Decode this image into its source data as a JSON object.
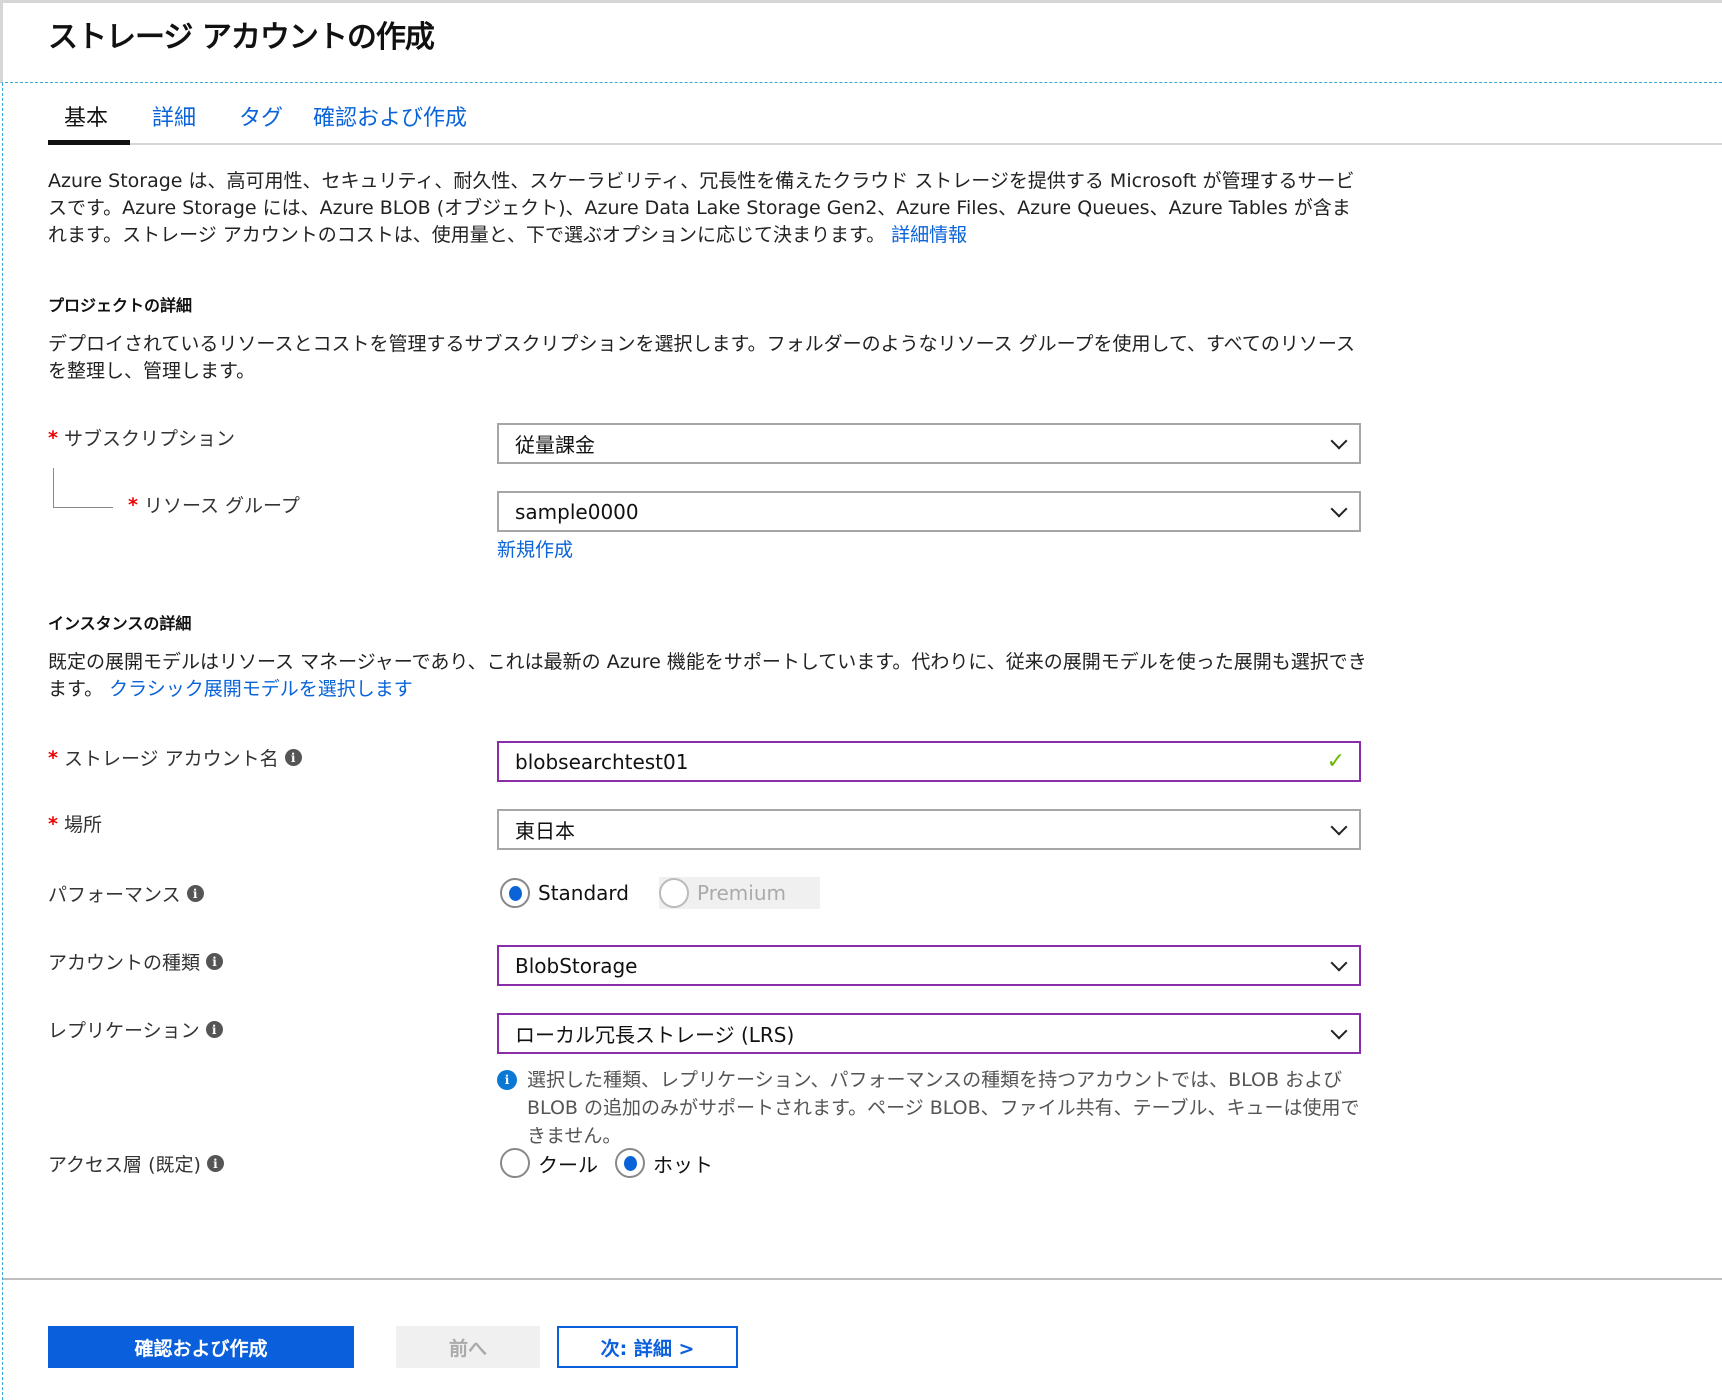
{
  "title": "ストレージ アカウントの作成",
  "tabs": [
    {
      "label": "基本"
    },
    {
      "label": "詳細"
    },
    {
      "label": "タグ"
    },
    {
      "label": "確認および作成"
    }
  ],
  "intro": {
    "text": "Azure Storage は、高可用性、セキュリティ、耐久性、スケーラビリティ、冗長性を備えたクラウド ストレージを提供する Microsoft が管理するサービスです。Azure Storage には、Azure BLOB (オブジェクト)、Azure Data Lake Storage Gen2、Azure Files、Azure Queues、Azure Tables が含まれます。ストレージ アカウントのコストは、使用量と、下で選ぶオプションに応じて決まります。 ",
    "link": "詳細情報"
  },
  "project": {
    "heading": "プロジェクトの詳細",
    "desc": "デプロイされているリソースとコストを管理するサブスクリプションを選択します。フォルダーのようなリソース グループを使用して、すべてのリソースを整理し、管理します。",
    "subscription": {
      "label": "サブスクリプション",
      "value": "従量課金"
    },
    "resource_group": {
      "label": "リソース グループ",
      "value": "sample0000",
      "create_new": "新規作成"
    }
  },
  "instance": {
    "heading": "インスタンスの詳細",
    "desc": "既定の展開モデルはリソース マネージャーであり、これは最新の Azure 機能をサポートしています。代わりに、従来の展開モデルを使った展開も選択できます。 ",
    "link": "クラシック展開モデルを選択します",
    "account_name": {
      "label": "ストレージ アカウント名",
      "value": "blobsearchtest01"
    },
    "location": {
      "label": "場所",
      "value": "東日本"
    },
    "performance": {
      "label": "パフォーマンス",
      "options": [
        "Standard",
        "Premium"
      ],
      "selected": "Standard"
    },
    "account_kind": {
      "label": "アカウントの種類",
      "value": "BlobStorage"
    },
    "replication": {
      "label": "レプリケーション",
      "value": "ローカル冗長ストレージ (LRS)",
      "note": "選択した種類、レプリケーション、パフォーマンスの種類を持つアカウントでは、BLOB および BLOB の追加のみがサポートされます。ページ BLOB、ファイル共有、テーブル、キューは使用できません。"
    },
    "access_tier": {
      "label": "アクセス層 (既定)",
      "options": [
        "クール",
        "ホット"
      ],
      "selected": "ホット"
    }
  },
  "required_mark": "*",
  "info_glyph": "i",
  "check_glyph": "✓",
  "footer": {
    "review_create": "確認および作成",
    "prev": "前へ",
    "next": "次: 詳細 >"
  },
  "colors": {
    "accent": "#0a64d8",
    "selected_border": "#8a2da8",
    "valid": "#6bb700"
  }
}
